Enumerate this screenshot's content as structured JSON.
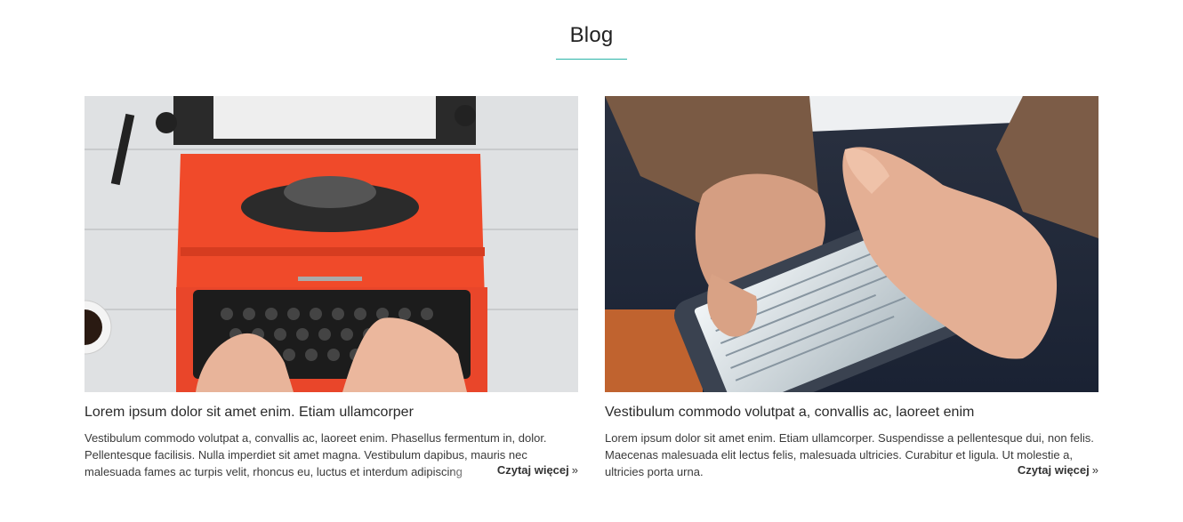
{
  "section": {
    "title": "Blog"
  },
  "posts": [
    {
      "title": "Lorem ipsum dolor sit amet enim. Etiam ullamcorper",
      "excerpt": "Vestibulum commodo volutpat a, convallis ac, laoreet enim. Phasellus fermentum in, dolor. Pellentesque facilisis. Nulla imperdiet sit amet magna. Vestibulum dapibus, mauris nec malesuada fames ac turpis velit, rhoncus eu, luctus et interdum adipiscing",
      "read_more": "Czytaj więcej",
      "image": "typewriter-photo"
    },
    {
      "title": "Vestibulum commodo volutpat a, convallis ac, laoreet enim",
      "excerpt": "Lorem ipsum dolor sit amet enim. Etiam ullamcorper. Suspendisse a pellentesque dui, non felis. Maecenas malesuada elit lectus felis, malesuada ultricies. Curabitur et ligula. Ut molestie a, ultricies porta urna.",
      "read_more": "Czytaj więcej",
      "image": "smartphone-photo"
    }
  ],
  "icons": {
    "read_more": "double-chevron-right-icon"
  },
  "colors": {
    "accent": "#2bb5a8",
    "text": "#333333"
  }
}
